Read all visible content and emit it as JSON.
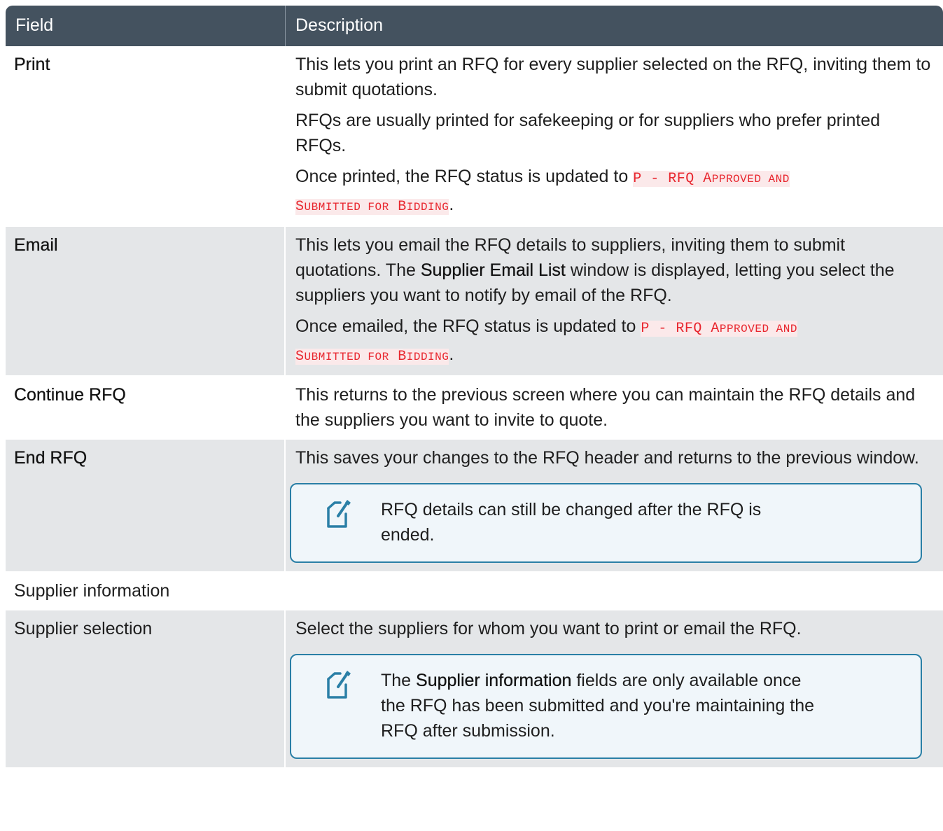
{
  "header": {
    "col_field": "Field",
    "col_description": "Description"
  },
  "rows": [
    {
      "field": "Print",
      "p1": "This lets you print an RFQ for every supplier selected on the RFQ, inviting them to submit quotations.",
      "p2": "RFQs are usually printed for safekeeping or for suppliers who prefer printed RFQs.",
      "p3_prefix": "Once printed, the RFQ status is updated to ",
      "p3_code": "P - RFQ APPROVED AND SUBMITTED FOR BIDDING",
      "p3_suffix": "."
    },
    {
      "field": "Email",
      "p1_a": "This lets you email the RFQ details to suppliers, inviting them to submit quotations. The ",
      "p1_bold": "Supplier Email List",
      "p1_b": " window is displayed, letting you select the suppliers you want to notify by email of the RFQ.",
      "p2_prefix": "Once emailed, the RFQ status is updated to ",
      "p2_code": "P - RFQ APPROVED AND SUBMITTED FOR BIDDING",
      "p2_suffix": "."
    },
    {
      "field": "Continue RFQ",
      "p1": "This returns to the previous screen where you can maintain the RFQ details and the suppliers you want to invite to quote."
    },
    {
      "field": "End RFQ",
      "p1": "This saves your changes to the RFQ header and returns to the previous window.",
      "note": "RFQ details can still be changed after the RFQ is ended.",
      "note_icon": "note-edit-icon"
    },
    {
      "field": "Supplier information"
    },
    {
      "field": "Supplier selection",
      "p1": "Select the suppliers for whom you want to print or email the RFQ.",
      "note_a": "The ",
      "note_bold": "Supplier information",
      "note_b": " fields are only available once the RFQ has been submitted and you're maintaining the RFQ after submission.",
      "note_icon": "note-edit-icon"
    }
  ],
  "colors": {
    "header_bg": "#44525f",
    "code_text": "#e8262e",
    "code_bg": "#fbe9ea",
    "note_border": "#2a7fa6"
  }
}
